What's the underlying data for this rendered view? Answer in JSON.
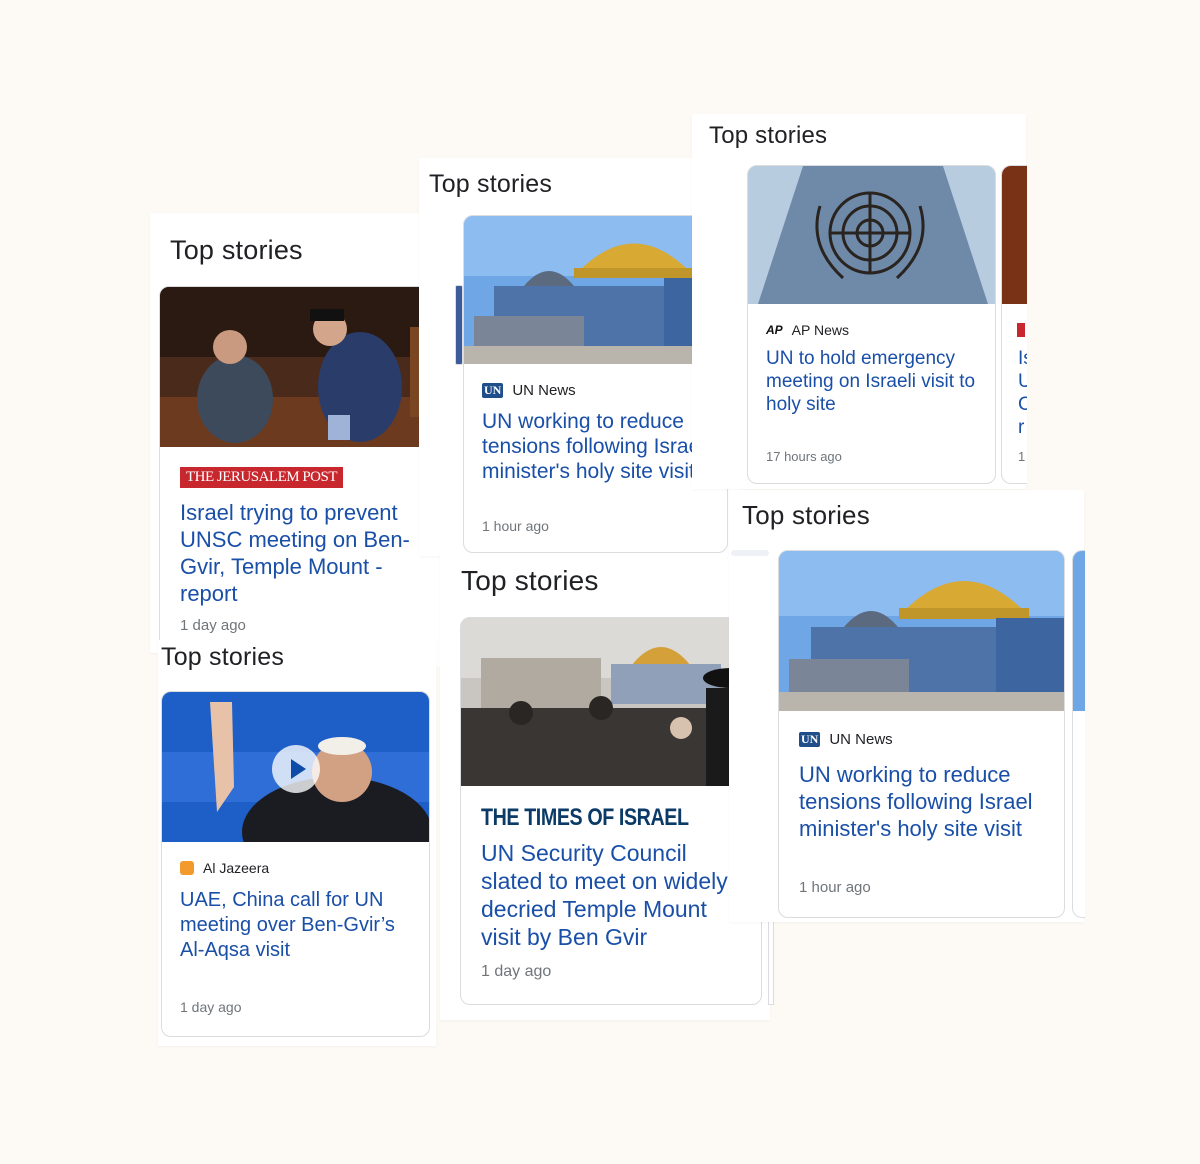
{
  "section_title": "Top stories",
  "panels": {
    "jpost": {
      "source": "THE JERUSALEM POST",
      "headline": "Israel trying to prevent UNSC meeting on Ben-Gvir, Temple Mount - report",
      "time": "1 day ago"
    },
    "un_news_a": {
      "source": "UN News",
      "headline": "UN working to reduce tensions following Israel minister's holy site visit",
      "time": "1 hour ago"
    },
    "ap_news": {
      "source": "AP News",
      "headline": "UN to hold emergency meeting on Israeli visit to holy site",
      "time": "17 hours ago",
      "next_card_fragment": [
        "Is",
        "U",
        "C",
        "r"
      ],
      "next_card_time_fragment": "1"
    },
    "times_of_israel": {
      "source": "THE TIMES OF ISRAEL",
      "headline": "UN Security Council slated to meet on widely decried Temple Mount visit by Ben Gvir",
      "time": "1 day ago"
    },
    "aljazeera": {
      "source": "Al Jazeera",
      "headline": "UAE, China call for UN meeting over Ben-Gvir’s Al-Aqsa visit",
      "time": "1 day ago"
    },
    "un_news_b": {
      "source": "UN News",
      "headline": "UN working to reduce tensions following Israel minister's holy site visit",
      "time": "1 hour ago"
    }
  },
  "source_logos": {
    "un": "UN",
    "ap": "AP"
  },
  "icons": [
    "play-icon",
    "un-emblem"
  ],
  "colors": {
    "headline": "#1a4fa8",
    "background": "#fdf9f4",
    "jpost_red": "#c8272d",
    "toi_navy": "#0b3a66"
  }
}
